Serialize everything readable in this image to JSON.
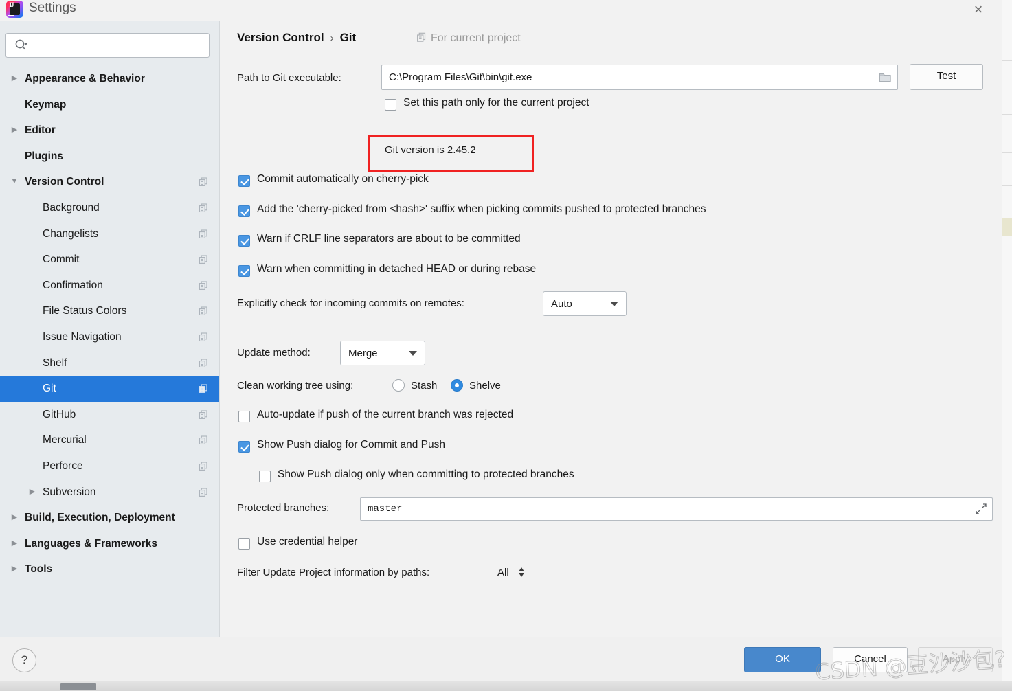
{
  "window": {
    "title": "Settings",
    "logo_text": "IJ",
    "close_label": "×"
  },
  "search": {
    "value": "",
    "placeholder": ""
  },
  "sidebar": {
    "items": [
      {
        "label": "Appearance & Behavior",
        "level": 0,
        "twisty": "collapsed",
        "bold": true,
        "project_icon": false,
        "selected": false
      },
      {
        "label": "Keymap",
        "level": 0,
        "twisty": "none",
        "bold": true,
        "project_icon": false,
        "selected": false
      },
      {
        "label": "Editor",
        "level": 0,
        "twisty": "collapsed",
        "bold": true,
        "project_icon": false,
        "selected": false
      },
      {
        "label": "Plugins",
        "level": 0,
        "twisty": "none",
        "bold": true,
        "project_icon": false,
        "selected": false
      },
      {
        "label": "Version Control",
        "level": 0,
        "twisty": "expanded",
        "bold": true,
        "project_icon": true,
        "selected": false
      },
      {
        "label": "Background",
        "level": 1,
        "twisty": "none",
        "bold": false,
        "project_icon": true,
        "selected": false
      },
      {
        "label": "Changelists",
        "level": 1,
        "twisty": "none",
        "bold": false,
        "project_icon": true,
        "selected": false
      },
      {
        "label": "Commit",
        "level": 1,
        "twisty": "none",
        "bold": false,
        "project_icon": true,
        "selected": false
      },
      {
        "label": "Confirmation",
        "level": 1,
        "twisty": "none",
        "bold": false,
        "project_icon": true,
        "selected": false
      },
      {
        "label": "File Status Colors",
        "level": 1,
        "twisty": "none",
        "bold": false,
        "project_icon": true,
        "selected": false
      },
      {
        "label": "Issue Navigation",
        "level": 1,
        "twisty": "none",
        "bold": false,
        "project_icon": true,
        "selected": false
      },
      {
        "label": "Shelf",
        "level": 1,
        "twisty": "none",
        "bold": false,
        "project_icon": true,
        "selected": false
      },
      {
        "label": "Git",
        "level": 1,
        "twisty": "none",
        "bold": false,
        "project_icon": true,
        "selected": true
      },
      {
        "label": "GitHub",
        "level": 1,
        "twisty": "none",
        "bold": false,
        "project_icon": true,
        "selected": false
      },
      {
        "label": "Mercurial",
        "level": 1,
        "twisty": "none",
        "bold": false,
        "project_icon": true,
        "selected": false
      },
      {
        "label": "Perforce",
        "level": 1,
        "twisty": "none",
        "bold": false,
        "project_icon": true,
        "selected": false
      },
      {
        "label": "Subversion",
        "level": 1,
        "twisty": "collapsed",
        "bold": false,
        "project_icon": true,
        "selected": false
      },
      {
        "label": "Build, Execution, Deployment",
        "level": 0,
        "twisty": "collapsed",
        "bold": true,
        "project_icon": false,
        "selected": false
      },
      {
        "label": "Languages & Frameworks",
        "level": 0,
        "twisty": "collapsed",
        "bold": true,
        "project_icon": false,
        "selected": false
      },
      {
        "label": "Tools",
        "level": 0,
        "twisty": "collapsed",
        "bold": true,
        "project_icon": false,
        "selected": false
      }
    ]
  },
  "content": {
    "breadcrumb": {
      "parent": "Version Control",
      "separator": "›",
      "current": "Git"
    },
    "scope_label": "For current project",
    "path_row": {
      "label": "Path to Git executable:",
      "value": "C:\\Program Files\\Git\\bin\\git.exe",
      "test_button": "Test"
    },
    "set_path_checkbox": {
      "label": "Set this path only for the current project",
      "checked": false
    },
    "git_version": "Git version is 2.45.2",
    "checkboxes": [
      {
        "label": "Commit automatically on cherry-pick",
        "checked": true
      },
      {
        "label": "Add the 'cherry-picked from <hash>' suffix when picking commits pushed to protected branches",
        "checked": true
      },
      {
        "label": "Warn if CRLF line separators are about to be committed",
        "checked": true
      },
      {
        "label": "Warn when committing in detached HEAD or during rebase",
        "checked": true
      }
    ],
    "incoming_commits": {
      "label": "Explicitly check for incoming commits on remotes:",
      "value": "Auto"
    },
    "update_method": {
      "label": "Update method:",
      "value": "Merge"
    },
    "clean_working_tree": {
      "label": "Clean working tree using:",
      "options": [
        "Stash",
        "Shelve"
      ],
      "selected": "Shelve"
    },
    "auto_update": {
      "label": "Auto-update if push of the current branch was rejected",
      "checked": false
    },
    "show_push_dialog": {
      "label": "Show Push dialog for Commit and Push",
      "checked": true
    },
    "show_push_protected": {
      "label": "Show Push dialog only when committing to protected branches",
      "checked": false
    },
    "protected_branches": {
      "label": "Protected branches:",
      "value": "master"
    },
    "use_credential_helper": {
      "label": "Use credential helper",
      "checked": false
    },
    "filter_paths": {
      "label": "Filter Update Project information by paths:",
      "value": "All"
    }
  },
  "footer": {
    "help_label": "?",
    "ok_label": "OK",
    "cancel_label": "Cancel",
    "apply_label": "Apply"
  },
  "watermark": "CSDN @豆沙沙包?",
  "colors": {
    "accent": "#2579da",
    "primary_button": "#4888cc",
    "checkbox_on": "#4a97e3",
    "radio_on": "#2f8ae0",
    "annotation": "#f02222",
    "sidebar_bg": "#e7ebee",
    "content_bg": "#f2f2f2"
  }
}
